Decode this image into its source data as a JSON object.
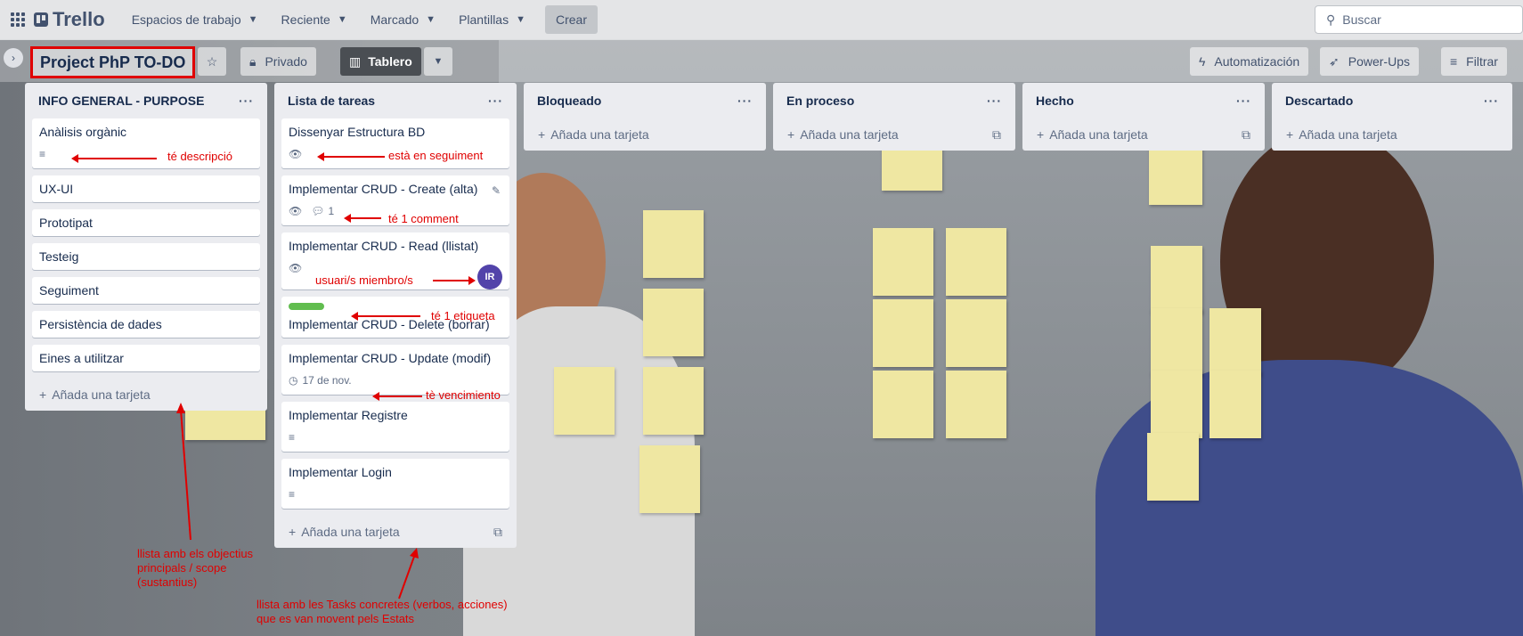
{
  "topbar": {
    "app_name": "Trello",
    "menus": [
      "Espacios de trabajo",
      "Reciente",
      "Marcado",
      "Plantillas"
    ],
    "create_label": "Crear",
    "search_placeholder": "Buscar"
  },
  "board": {
    "title": "Project PhP TO-DO",
    "visibility": "Privado",
    "view": "Tablero",
    "automation": "Automatización",
    "powerups": "Power-Ups",
    "filter": "Filtrar"
  },
  "lists": [
    {
      "title": "INFO GENERAL - PURPOSE",
      "add_label": "Añada una tarjeta",
      "cards": [
        {
          "title": "Anàlisis orgànic",
          "has_description": true
        },
        {
          "title": "UX-UI"
        },
        {
          "title": "Prototipat"
        },
        {
          "title": "Testeig"
        },
        {
          "title": "Seguiment"
        },
        {
          "title": "Persistència de dades"
        },
        {
          "title": "Eines a utilitzar"
        }
      ]
    },
    {
      "title": "Lista de tareas",
      "add_label": "Añada una tarjeta",
      "cards": [
        {
          "title": "Dissenyar Estructura BD",
          "watching": true
        },
        {
          "title": "Implementar CRUD - Create (alta)",
          "watching": true,
          "comments": "1"
        },
        {
          "title": "Implementar CRUD - Read (llistat)",
          "watching": true,
          "member_initials": "IR"
        },
        {
          "title": "Implementar CRUD - Delete (borrar)",
          "label_color": "#61bd4f"
        },
        {
          "title": "Implementar CRUD - Update (modif)",
          "due": "17 de nov."
        },
        {
          "title": "Implementar Registre",
          "has_description": true
        },
        {
          "title": "Implementar Login",
          "has_description": true
        }
      ]
    },
    {
      "title": "Bloqueado",
      "add_label": "Añada una tarjeta",
      "cards": []
    },
    {
      "title": "En proceso",
      "add_label": "Añada una tarjeta",
      "cards": []
    },
    {
      "title": "Hecho",
      "add_label": "Añada una tarjeta",
      "cards": []
    },
    {
      "title": "Descartado",
      "add_label": "Añada una tarjeta",
      "cards": []
    }
  ],
  "annotations": {
    "description": "té descripció",
    "watching": "està en seguiment",
    "comment": "té 1 comment",
    "members": "usuari/s miembro/s",
    "label": "té 1 etiqueta",
    "due": "tè vencimiento",
    "list1_line1": "llista amb els objectius",
    "list1_line2": "principals / scope",
    "list1_line3": "(sustantius)",
    "list2_line1": "llista amb les Tasks concretes (verbos, acciones)",
    "list2_line2": "que es van movent pels Estats"
  },
  "colors": {
    "annotation": "#e00000",
    "label_green": "#61bd4f",
    "avatar": "#5243aa"
  }
}
